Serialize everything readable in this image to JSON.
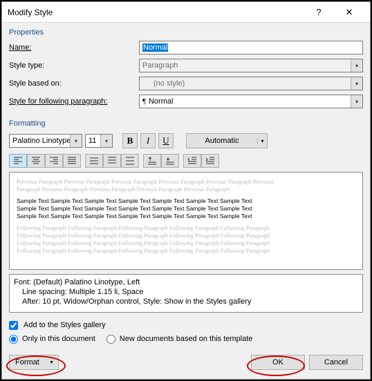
{
  "titlebar": {
    "title": "Modify Style"
  },
  "sections": {
    "properties": "Properties",
    "formatting": "Formatting"
  },
  "props": {
    "name_label": "Name:",
    "name_value": "Normal",
    "type_label": "Style type:",
    "type_value": "Paragraph",
    "based_label": "Style based on:",
    "based_value": "(no style)",
    "following_label": "Style for following paragraph:",
    "following_value": "Normal"
  },
  "formatting": {
    "font": "Palatino Linotype",
    "size": "11",
    "color_label": "Automatic"
  },
  "preview": {
    "prev_line": "Previous Paragraph Previous Paragraph Previous Paragraph Previous Paragraph Previous Paragraph Previous",
    "prev_line2": "Paragraph Previous Paragraph Previous Paragraph Previous Paragraph Previous Paragraph",
    "sample": "Sample Text Sample Text Sample Text Sample Text Sample Text Sample Text Sample Text",
    "next_line": "Following Paragraph Following Paragraph Following Paragraph Following Paragraph Following Paragraph",
    "next_line2": "Following Paragraph Following Paragraph Following Paragraph Following Paragraph Following Paragraph"
  },
  "description": {
    "line1": "Font: (Default) Palatino Linotype, Left",
    "line2": "Line spacing:  Multiple 1.15 li, Space",
    "line3": "After:  10 pt, Widow/Orphan control, Style: Show in the Styles gallery"
  },
  "options": {
    "add_gallery": "Add to the Styles gallery",
    "only_doc": "Only in this document",
    "new_docs": "New documents based on this template"
  },
  "buttons": {
    "format": "Format",
    "ok": "OK",
    "cancel": "Cancel"
  }
}
